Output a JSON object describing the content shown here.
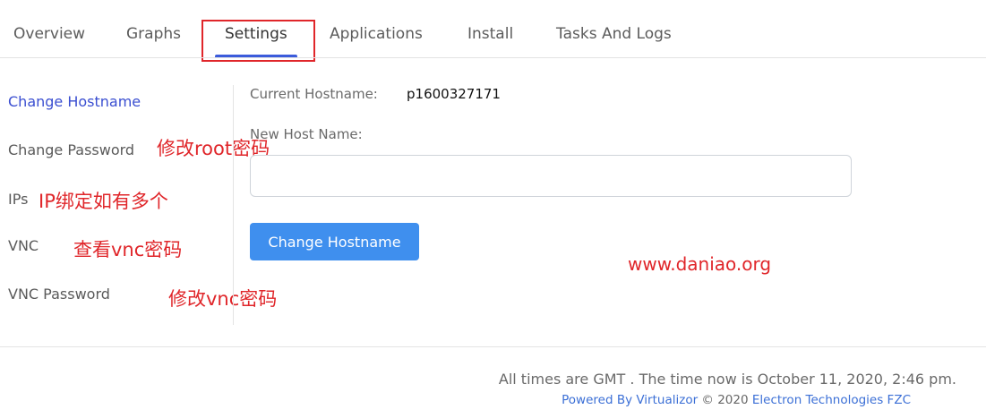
{
  "tabs": [
    {
      "label": "Overview"
    },
    {
      "label": "Graphs"
    },
    {
      "label": "Settings",
      "active": true
    },
    {
      "label": "Applications"
    },
    {
      "label": "Install"
    },
    {
      "label": "Tasks And Logs"
    }
  ],
  "sidebar": {
    "items": [
      {
        "label": "Change Hostname",
        "active": true
      },
      {
        "label": "Change Password"
      },
      {
        "label": "IPs"
      },
      {
        "label": "VNC"
      },
      {
        "label": "VNC Password"
      }
    ]
  },
  "annotations": {
    "change_password": "修改root密码",
    "ips": "IP绑定如有多个",
    "vnc": "查看vnc密码",
    "vnc_password": "修改vnc密码",
    "watermark": "www.daniao.org"
  },
  "main": {
    "current_hostname_label": "Current Hostname:",
    "current_hostname_value": "p1600327171",
    "new_hostname_label": "New Host Name:",
    "new_hostname_value": "",
    "submit_label": "Change Hostname"
  },
  "footer": {
    "time_text": "All times are GMT . The time now is October 11, 2020, 2:46 pm.",
    "powered_by": "Powered By Virtualizor",
    "copyright": " © 2020 ",
    "company": "Electron Technologies FZC"
  },
  "colors": {
    "accent": "#3b5bdb",
    "button": "#3f8fee",
    "annotation_red": "#e0262a"
  }
}
